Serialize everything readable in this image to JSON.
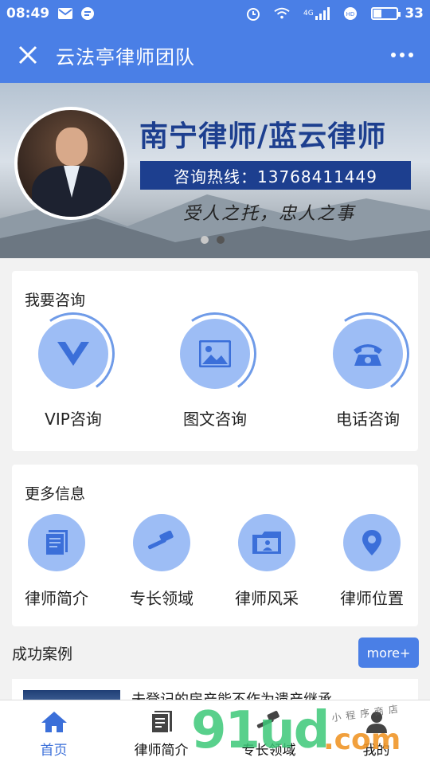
{
  "status_bar": {
    "time": "08:49",
    "network": "4G",
    "battery": "33"
  },
  "nav": {
    "title": "云法亭律师团队"
  },
  "banner": {
    "headline": "南宁律师/蓝云律师",
    "hotline": "咨询热线：13768411449",
    "slogan": "受人之托，忠人之事"
  },
  "consult": {
    "heading": "我要咨询",
    "items": [
      {
        "label": "VIP咨询",
        "icon": "vip-icon"
      },
      {
        "label": "图文咨询",
        "icon": "image-icon"
      },
      {
        "label": "电话咨询",
        "icon": "phone-icon"
      }
    ]
  },
  "info": {
    "heading": "更多信息",
    "items": [
      {
        "label": "律师简介",
        "icon": "document-icon"
      },
      {
        "label": "专长领域",
        "icon": "gavel-icon"
      },
      {
        "label": "律师风采",
        "icon": "folder-icon"
      },
      {
        "label": "律师位置",
        "icon": "location-icon"
      }
    ]
  },
  "cases": {
    "heading": "成功案例",
    "more_label": "more+",
    "first_case_title": "未登记的房产能不作为遗产继承"
  },
  "tabbar": {
    "items": [
      {
        "label": "首页",
        "icon": "home-icon",
        "active": true
      },
      {
        "label": "律师简介",
        "icon": "document-icon",
        "active": false
      },
      {
        "label": "专长领域",
        "icon": "gavel-icon",
        "active": false
      },
      {
        "label": "我的",
        "icon": "user-icon",
        "active": false
      }
    ]
  },
  "watermark": {
    "brand": "91ud",
    "suffix": ".com",
    "tagline": "小程序商店"
  },
  "colors": {
    "primary": "#4a7fe6",
    "icon_circle": "#9dbdf5",
    "banner_text": "#1d3f8f"
  }
}
